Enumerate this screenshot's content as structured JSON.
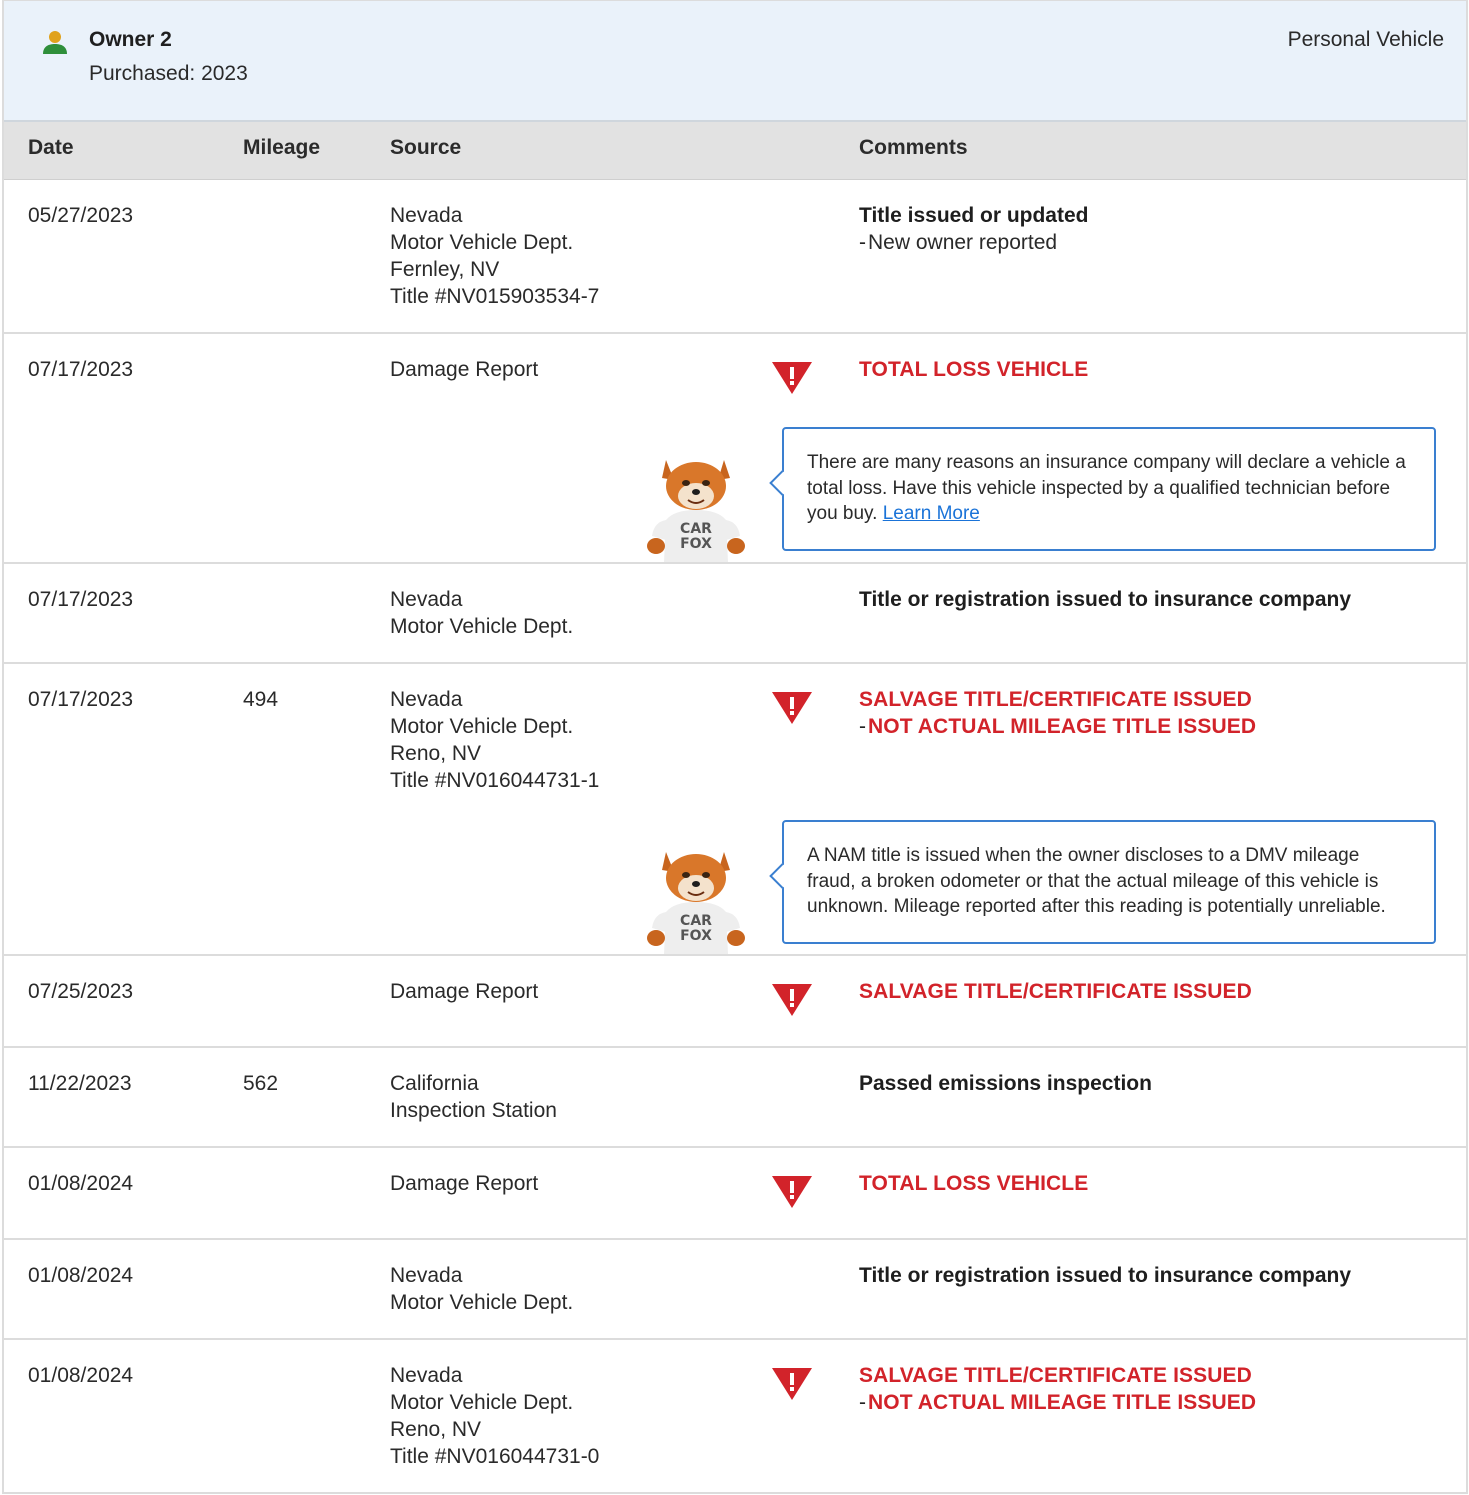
{
  "owner": {
    "name": "Owner 2",
    "purchased": "Purchased: 2023",
    "type": "Personal Vehicle",
    "icon": "person-icon"
  },
  "table": {
    "headers": {
      "date": "Date",
      "mileage": "Mileage",
      "source": "Source",
      "comments": "Comments"
    },
    "rows": [
      {
        "date": "05/27/2023",
        "mileage": "",
        "source": [
          "Nevada",
          "Motor Vehicle Dept.",
          "Fernley, NV",
          "Title #NV015903534-7"
        ],
        "comment_title": "Title issued or updated",
        "comment_sub": "New owner reported"
      },
      {
        "date": "07/17/2023",
        "mileage": "",
        "source": [
          "Damage Report"
        ],
        "alert": "TOTAL LOSS VEHICLE",
        "tip": "There are many reasons an insurance company will declare a vehicle a total loss. Have this vehicle inspected by a qualified technician before you buy.",
        "tip_link": "Learn More"
      },
      {
        "date": "07/17/2023",
        "mileage": "",
        "source": [
          "Nevada",
          "Motor Vehicle Dept."
        ],
        "comment_title": "Title or registration issued to insurance company"
      },
      {
        "date": "07/17/2023",
        "mileage": "494",
        "source": [
          "Nevada",
          "Motor Vehicle Dept.",
          "Reno, NV",
          "Title #NV016044731-1"
        ],
        "alert": "SALVAGE TITLE/CERTIFICATE ISSUED",
        "alert_sub": "NOT ACTUAL MILEAGE TITLE ISSUED",
        "tip": "A NAM title is issued when the owner discloses to a DMV mileage fraud, a broken odometer or that the actual mileage of this vehicle is unknown. Mileage reported after this reading is potentially unreliable."
      },
      {
        "date": "07/25/2023",
        "mileage": "",
        "source": [
          "Damage Report"
        ],
        "alert": "SALVAGE TITLE/CERTIFICATE ISSUED"
      },
      {
        "date": "11/22/2023",
        "mileage": "562",
        "source": [
          "California",
          "Inspection Station"
        ],
        "comment_title": "Passed emissions inspection"
      },
      {
        "date": "01/08/2024",
        "mileage": "",
        "source": [
          "Damage Report"
        ],
        "alert": "TOTAL LOSS VEHICLE"
      },
      {
        "date": "01/08/2024",
        "mileage": "",
        "source": [
          "Nevada",
          "Motor Vehicle Dept."
        ],
        "comment_title": "Title or registration issued to insurance company"
      },
      {
        "date": "01/08/2024",
        "mileage": "",
        "source": [
          "Nevada",
          "Motor Vehicle Dept.",
          "Reno, NV",
          "Title #NV016044731-0"
        ],
        "alert": "SALVAGE TITLE/CERTIFICATE ISSUED",
        "alert_sub": "NOT ACTUAL MILEAGE TITLE ISSUED"
      }
    ]
  },
  "mascot": {
    "shirt_text_line1": "CAR",
    "shirt_text_line2": "FOX"
  },
  "colors": {
    "alert_red": "#d2232a",
    "link_blue": "#1a73d8",
    "tip_border": "#3a7fd0",
    "header_bg": "#eaf2fa"
  }
}
